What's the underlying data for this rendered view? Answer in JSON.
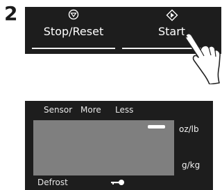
{
  "step": {
    "number": "2"
  },
  "control_panel": {
    "stop_reset": {
      "label": "Stop/Reset",
      "icon": "stop-icon"
    },
    "start": {
      "label": "Start",
      "icon": "start-icon"
    }
  },
  "display": {
    "modes": [
      "Sensor",
      "More",
      "Less"
    ],
    "units": {
      "weight_imperial": "oz/lb",
      "weight_metric": "g/kg"
    },
    "defrost": "Defrost",
    "child_lock_icon": "key-icon"
  },
  "colors": {
    "panel": "#1d1d1d",
    "screen": "#7f7f7f",
    "text": "#ffffff"
  }
}
